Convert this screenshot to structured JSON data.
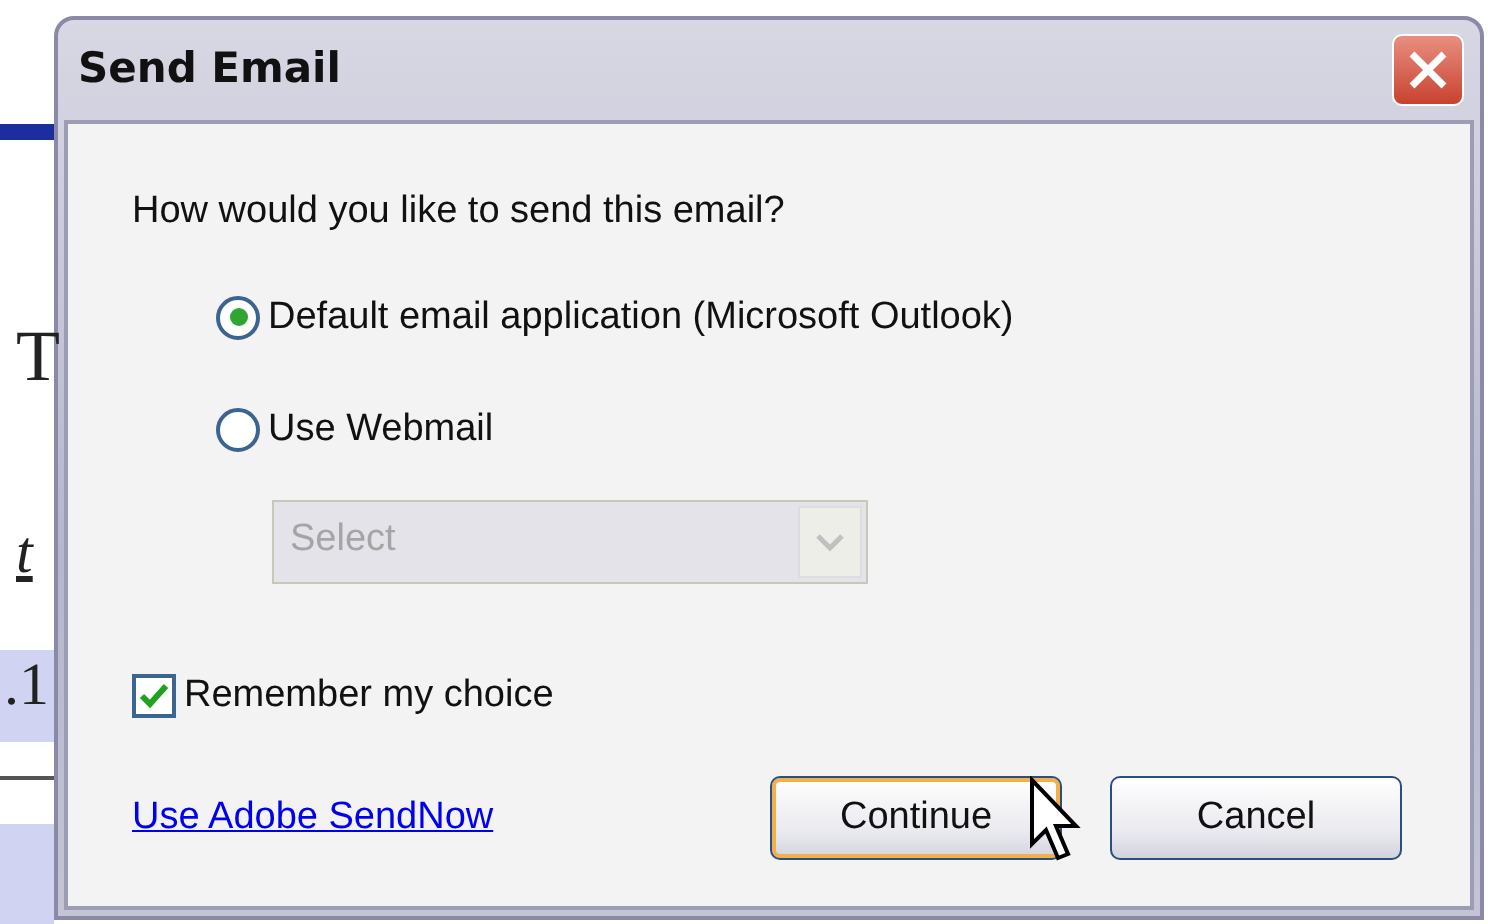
{
  "window": {
    "title": "Send Email"
  },
  "background_fragments": [
    {
      "text": "T",
      "kind": "serif"
    },
    {
      "text": "t",
      "kind": "italic"
    },
    {
      "text": ".1",
      "kind": "shaded"
    }
  ],
  "prompt": "How would you like to send this email?",
  "options": [
    {
      "label": "Default email application (Microsoft Outlook)",
      "selected": true
    },
    {
      "label": "Use Webmail",
      "selected": false
    }
  ],
  "webmail_select": {
    "value": "Select",
    "disabled": true
  },
  "remember": {
    "label": "Remember my choice",
    "checked": true
  },
  "link": "Use Adobe SendNow",
  "buttons": [
    {
      "label": "Continue",
      "default": true
    },
    {
      "label": "Cancel",
      "default": false
    }
  ]
}
